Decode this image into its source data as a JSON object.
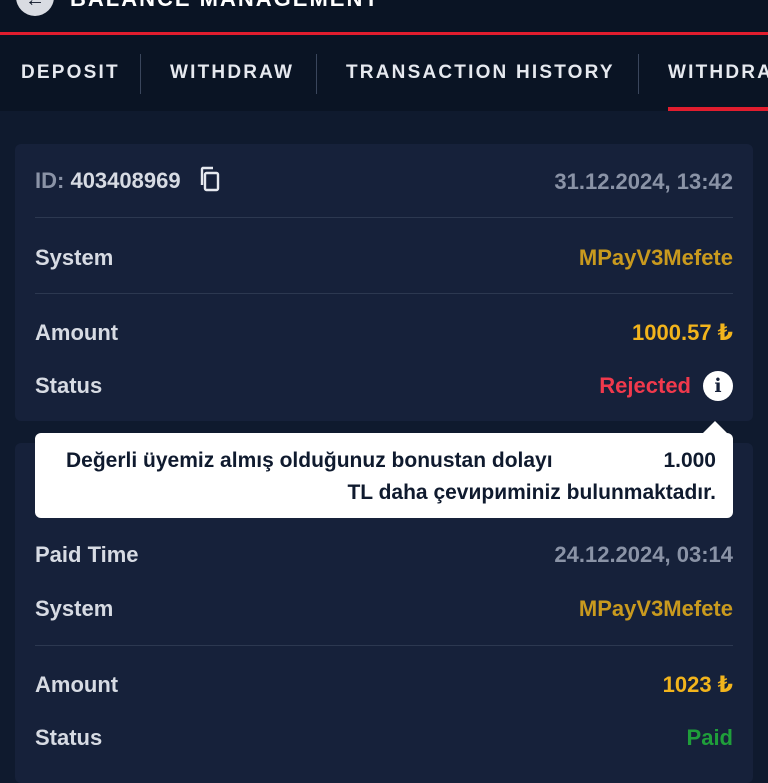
{
  "header": {
    "title": "BALANCE MANAGEMENT",
    "back_icon": "arrow-left-icon"
  },
  "tabs": [
    {
      "label": "DEPOSIT"
    },
    {
      "label": "WITHDRAW"
    },
    {
      "label": "TRANSACTION HISTORY"
    },
    {
      "label": "WITHDRA"
    }
  ],
  "active_tab_index": 3,
  "transactions": [
    {
      "id_label": "ID:",
      "id": "403408969",
      "datetime": "31.12.2024, 13:42",
      "system_label": "System",
      "system": "MPayV3Mefete",
      "amount_label": "Amount",
      "amount": "1000.57 ₺",
      "status_label": "Status",
      "status": "Rejected"
    },
    {
      "paid_time_label": "Paid Time",
      "paid_time": "24.12.2024, 03:14",
      "system_label": "System",
      "system": "MPayV3Mefete",
      "amount_label": "Amount",
      "amount": "1023 ₺",
      "status_label": "Status",
      "status": "Paid"
    }
  ],
  "tooltip": {
    "line1": "Değerli üyemiz almış olduğunuz bonustan dolayı",
    "amount": "1.000",
    "line2": "TL daha çevириminiz bulunmaktadır."
  },
  "colors": {
    "background": "#0f1a2e",
    "accent": "#e11d2e",
    "system": "#c99a1e",
    "amount": "#f2b41c",
    "rejected": "#f0394c",
    "paid": "#1f9e3a"
  }
}
